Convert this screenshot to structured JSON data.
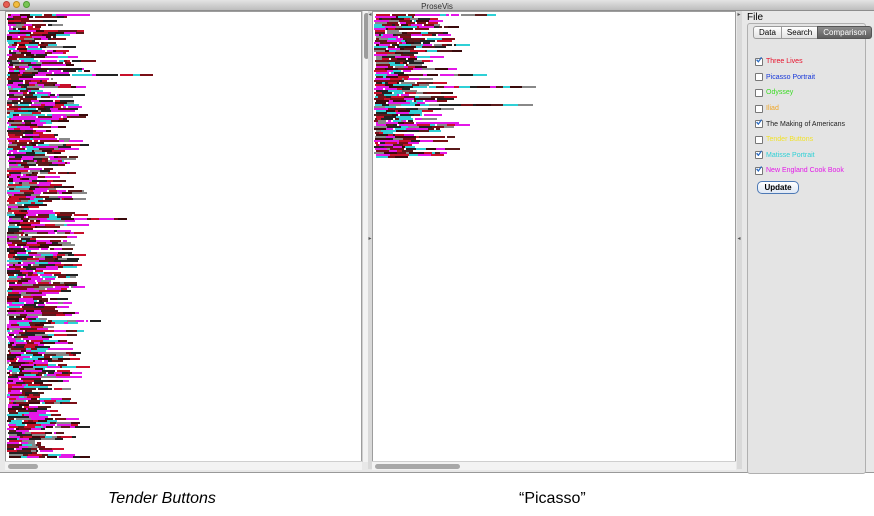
{
  "window": {
    "title": "ProseVis"
  },
  "menu": {
    "file_label": "File"
  },
  "tabs": [
    {
      "label": "Data",
      "active": false
    },
    {
      "label": "Search",
      "active": false
    },
    {
      "label": "Comparison",
      "active": true
    }
  ],
  "comparison": {
    "items": [
      {
        "label": "Three Lives",
        "color": "#e8102a",
        "checked": true
      },
      {
        "label": "Picasso Portrait",
        "color": "#1636d9",
        "checked": false
      },
      {
        "label": "Odyssey",
        "color": "#3cdc25",
        "checked": false
      },
      {
        "label": "Iliad",
        "color": "#f0a625",
        "checked": false
      },
      {
        "label": "The Making of Americans",
        "color": "#222222",
        "checked": true
      },
      {
        "label": "Tender Buttons",
        "color": "#f1e22a",
        "checked": false
      },
      {
        "label": "Matisse Portrait",
        "color": "#2fd0d6",
        "checked": true
      },
      {
        "label": "New England Cook Book",
        "color": "#e318e8",
        "checked": true
      }
    ],
    "update_label": "Update"
  },
  "captions": {
    "left": "Tender Buttons",
    "right": "“Picasso”"
  }
}
